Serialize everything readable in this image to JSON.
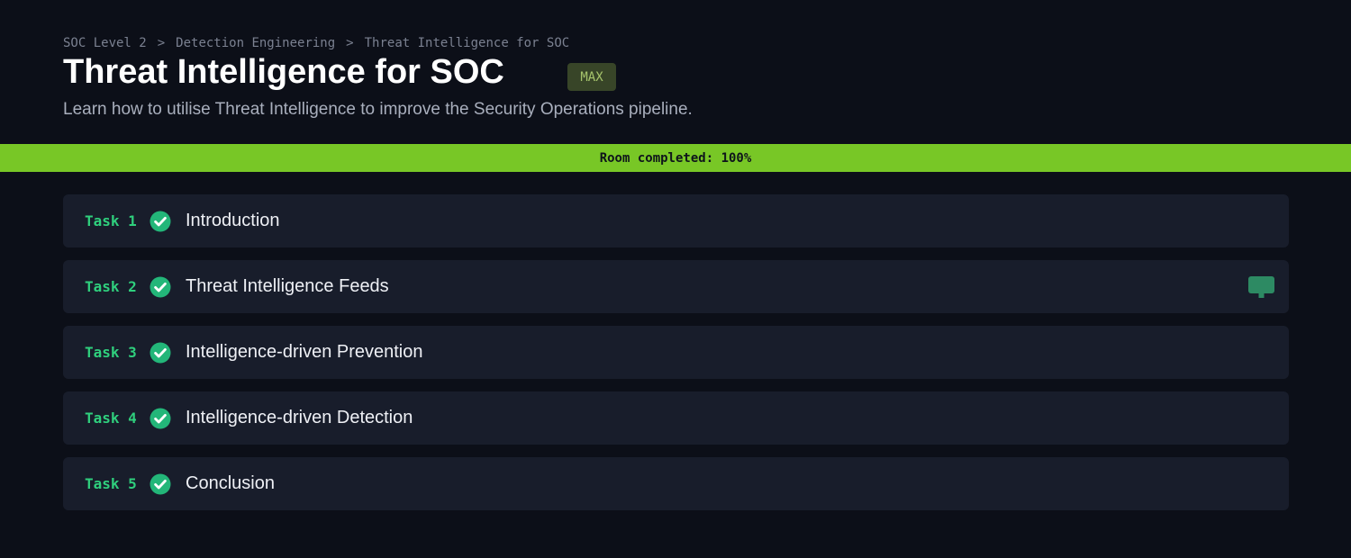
{
  "breadcrumb": {
    "items": [
      "SOC Level 2",
      "Detection Engineering",
      "Threat Intelligence for SOC"
    ],
    "separator": ">"
  },
  "header": {
    "title": "Threat Intelligence for SOC",
    "badge": "MAX",
    "subtitle": "Learn how to utilise Threat Intelligence to improve the Security Operations pipeline."
  },
  "progress": {
    "label": "Room completed: 100%",
    "percent": 100
  },
  "tasks": [
    {
      "number": "Task 1",
      "title": "Introduction",
      "completed": true
    },
    {
      "number": "Task 2",
      "title": "Threat Intelligence Feeds",
      "completed": true,
      "has_chat": true
    },
    {
      "number": "Task 3",
      "title": "Intelligence-driven Prevention",
      "completed": true
    },
    {
      "number": "Task 4",
      "title": "Intelligence-driven Detection",
      "completed": true
    },
    {
      "number": "Task 5",
      "title": "Conclusion",
      "completed": true
    }
  ],
  "icons": {
    "completed": "check-circle-icon",
    "chat": "chat-bubble-icon"
  },
  "colors": {
    "background": "#0c0f18",
    "accent_green": "#78c726",
    "task_label": "#2fcf7d",
    "check_fill": "#23b679",
    "chat_icon": "#2d8a63",
    "badge_bg": "#384528",
    "badge_text": "#a6c46c",
    "card_bg": "#181d2b"
  }
}
